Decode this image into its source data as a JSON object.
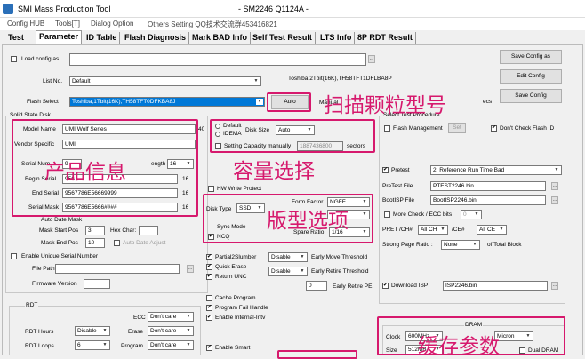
{
  "window": {
    "app_name": "SMI Mass Production Tool",
    "title": "- SM2246 Q1124A -"
  },
  "menu": [
    "Config HUB",
    "Tools[T]",
    "Dialog Option",
    "Others Setting QQ技术交流群453416821"
  ],
  "tabs": [
    "Test",
    "Parameter",
    "ID Table",
    "Flash Diagnosis",
    "Mark BAD Info",
    "Self Test Result",
    "LTS Info",
    "8P RDT Result"
  ],
  "active_tab": "Parameter",
  "config": {
    "load_config_label": "Load config as",
    "list_no_label": "List No.",
    "list_no_value": "Default",
    "flash_info": "Toshiba,2Tbit(16K),TH58TFT1DFLBA8P",
    "flash_select_label": "Flash Select",
    "flash_select_value": "Toshiba,1Tbit(16K),TH58TFT0DFKBA8J",
    "auto_button": "Auto",
    "manual_label": "Manual",
    "specs_label": "ecs"
  },
  "right_buttons": [
    "Save Config as",
    "Edit Config",
    "Save Config"
  ],
  "solid_state_disk": {
    "group_label": "Solid State Disk",
    "model_name_label": "Model Name",
    "model_name_value": "UMI Wolf Series",
    "model_len": "40",
    "vendor_specific_label": "Vendor Specific",
    "vendor_specific_value": "UMI",
    "serial_number_label": "Serial Num",
    "serial_prefix": "9",
    "length_label": "ength",
    "length_value": "16",
    "begin_serial_label": "Begin Serial",
    "begin_serial_value": "956",
    "end_serial_label": "End Serial",
    "end_serial_value": "9567786E56669999",
    "end_serial_len": "16",
    "serial_mask_label": "Serial Mask",
    "serial_mask_value": "9567786E5666####",
    "serial_mask_len": "16",
    "begin_serial_len": "16"
  },
  "date_mask": {
    "auto_date_mask_label": "Auto Date Mask",
    "mask_start_pos_label": "Mask Start Pos",
    "mask_start_pos_value": "3",
    "hex_char_label": "Hex Char:",
    "mask_end_pos_label": "Mask End Pos",
    "mask_end_pos_value": "10",
    "auto_date_adjust_label": "Auto Date Adjust",
    "enable_unique_serial_label": "Enable Unique Serial Number",
    "file_path_label": "File Path",
    "firmware_version_label": "Firmware Version"
  },
  "disk_size": {
    "default_label": "Default",
    "idema_label": "IDEMA",
    "disk_size_label": "Disk Size",
    "disk_size_value": "Auto",
    "setting_capacity_label": "Setting Capacity manually",
    "setting_capacity_value": "1887436800",
    "sectors_label": "sectors"
  },
  "disk_type": {
    "hw_write_protect_label": "HW Write Protect",
    "disk_type_label": "Disk Type",
    "disk_type_value": "SSD",
    "form_factor_label": "Form Factor",
    "form_factor_value": "NGFF",
    "sync_mode_label": "Sync Mode",
    "ncq_label": "NCQ",
    "spare_ratio_label": "Spare Ratio",
    "spare_ratio_value": "1/16",
    "partial_slumber_label": "Partial2Slumber",
    "quick_erase_label": "Quick Erase",
    "return_unc_label": "Return UNC",
    "early_move_label": "Early Move Threshold",
    "early_move_value": "Disable",
    "early_retire_label": "Early Retire Threshold",
    "early_retire_value": "Disable",
    "early_retire_pe_label": "Early Retire PE",
    "early_retire_pe_value": "0",
    "cache_program_label": "Cache Program",
    "program_fail_handle_label": "Program Fail Handle",
    "enable_internal_intv_label": "Enable Internal-Intv",
    "enable_smart_label": "Enable Smart"
  },
  "rdt": {
    "group_label": "RDT",
    "ecc_label": "ECC",
    "ecc_value": "Don't care",
    "rdt_hours_label": "RDT Hours",
    "rdt_hours_value": "Disable",
    "erase_label": "Erase",
    "erase_value": "Don't care",
    "rdt_loops_label": "RDT Loops",
    "rdt_loops_value": "6",
    "program_label": "Program",
    "program_value": "Don't care"
  },
  "test_procedure": {
    "group_label": "Select Test Procedure",
    "flash_management_label": "Flash Management",
    "set_button": "Set",
    "dont_check_flash_id_label": "Don't Check Flash ID",
    "pretest_label": "Pretest",
    "pretest_value": "2. Reference Run Time Bad",
    "pretest_file_label": "PreTest File",
    "pretest_file_value": "PTEST2246.bin",
    "bootisp_file_label": "BootISP File",
    "bootisp_file_value": "BootISP2246.bin",
    "more_check_label": "More Check / ECC bits",
    "more_check_value": "0",
    "pret_ch_label": "PRET /CH#",
    "pret_ch_value": "All CH",
    "ce_label": "/CE#",
    "ce_value": "All CE",
    "strong_page_label": "Strong Page Ratio :",
    "strong_page_value": "None",
    "of_total_block_label": "of Total Block",
    "download_isp_label": "Download ISP",
    "download_isp_value": "ISP2246.bin"
  },
  "dram": {
    "group_label": "DRAM",
    "clock_label": "Clock",
    "clock_value": "600MHz",
    "vendor_value": "Micron",
    "size_label": "Size",
    "size_value": "512MB",
    "dual_dram_label": "Dual DRAM"
  },
  "annotations": {
    "scan_particle_model": "扫描颗粒型号",
    "product_info": "产品信息",
    "capacity_select": "容量选择",
    "board_type_select": "版型选项",
    "cache_params": "缓存参数"
  },
  "colors": {
    "annotation": "#d6196d",
    "selection": "#0078d7"
  }
}
